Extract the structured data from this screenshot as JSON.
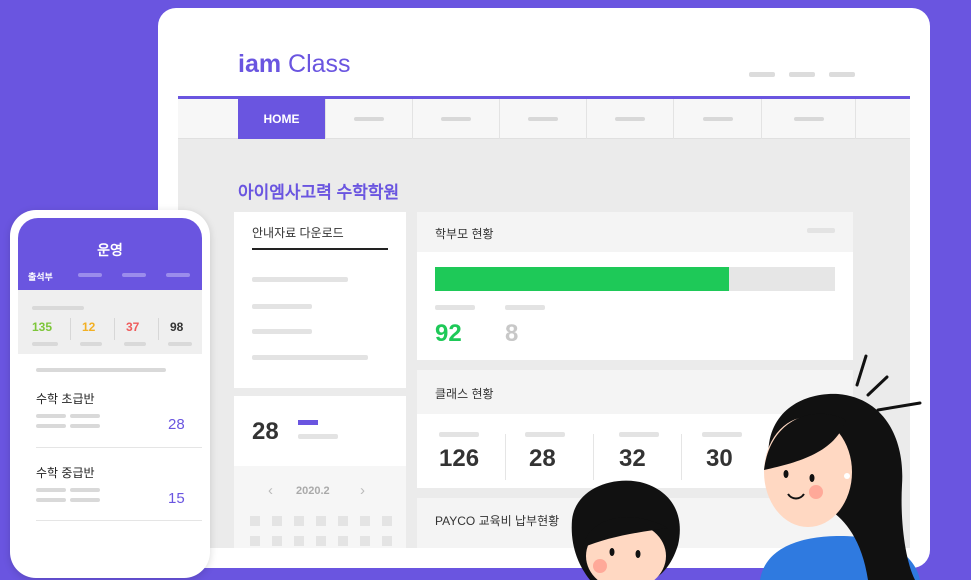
{
  "brand": {
    "logo_bold": "iam",
    "logo_regular": "Class",
    "accent": "#6a55e0",
    "green": "#1ec958"
  },
  "nav": {
    "home_label": "HOME"
  },
  "school": {
    "name": "아이엠사고력 수학학원"
  },
  "guide_panel": {
    "title": "안내자료 다운로드"
  },
  "parent_panel": {
    "title": "학부모 현황",
    "progress_fraction": 0.735,
    "registered": "92",
    "unregistered": "8"
  },
  "class_panel": {
    "title": "클래스 현황",
    "stats": [
      "126",
      "28",
      "32",
      "30"
    ]
  },
  "payment_panel": {
    "title": "PAYCO 교육비 납부현황"
  },
  "calendar_panel": {
    "count": "28",
    "month": "2020.2",
    "prev_icon": "chevron-left-icon",
    "next_icon": "chevron-right-icon"
  },
  "phone": {
    "title": "운영",
    "tab_label": "출석부",
    "stats": [
      "135",
      "12",
      "37",
      "98"
    ],
    "stat_colors": [
      "#7dc63a",
      "#f2b024",
      "#ef5b5b",
      "#333333"
    ],
    "classes": [
      {
        "name": "수학 초급반",
        "count": "28"
      },
      {
        "name": "수학 중급반",
        "count": "15"
      }
    ]
  }
}
